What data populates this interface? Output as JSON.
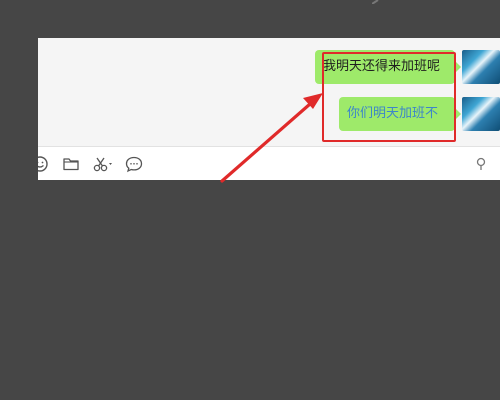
{
  "chat": {
    "messages": [
      {
        "text": "我明天还得来加班呢",
        "text_color": "#1f1f1f"
      },
      {
        "text": "你们明天加班不",
        "text_color": "#3d86c9"
      }
    ],
    "bubble_color": "#9eea6a"
  },
  "toolbar": {
    "icons": [
      "emoji-icon",
      "folder-icon",
      "scissors-icon",
      "chat-bubble-icon",
      "pin-icon"
    ]
  },
  "annotation": {
    "highlight_color": "#e02a2a",
    "arrow_color": "#e02a2a"
  },
  "colors": {
    "background": "#464646",
    "chat_background": "#f5f5f5",
    "toolbar_background": "#ffffff"
  }
}
